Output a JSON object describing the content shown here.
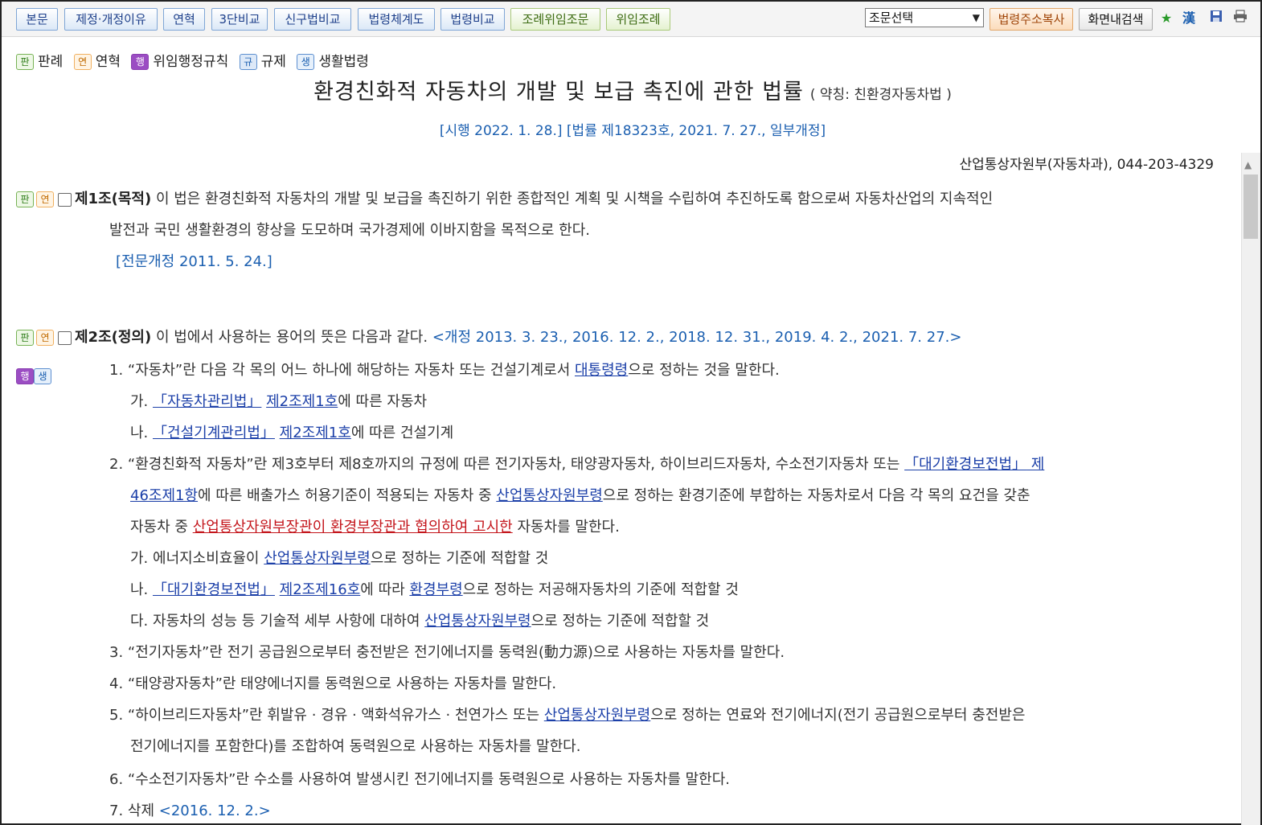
{
  "toolbar": {
    "buttons": [
      "본문",
      "제정·개정이유",
      "연혁",
      "3단비교",
      "신구법비교",
      "법령체계도",
      "법령비교",
      "조례위임조문",
      "위임조례"
    ],
    "select_value": "조문선택",
    "copy_button": "법령주소복사",
    "search_button": "화면내검색",
    "hanja_icon": "漢"
  },
  "legend": [
    {
      "badge": "판",
      "label": "판례"
    },
    {
      "badge": "연",
      "label": "연혁"
    },
    {
      "badge": "행",
      "label": "위임행정규칙"
    },
    {
      "badge": "규",
      "label": "규제"
    },
    {
      "badge": "생",
      "label": "생활법령"
    }
  ],
  "law": {
    "title": "환경친화적 자동차의 개발 및 보급 촉진에 관한 법률",
    "abbr": "( 약칭: 친환경자동차법 )",
    "enforcement": "[시행 2022. 1. 28.] [법률 제18323호, 2021. 7. 27., 일부개정]",
    "ministry": "산업통상자원부(자동차과), 044-203-4329"
  },
  "art1": {
    "badge1": "판",
    "badge2": "연",
    "title": "제1조(목적)",
    "text1": " 이 법은 환경친화적 자동차의 개발 및 보급을 촉진하기 위한 종합적인 계획 및 시책을 수립하여 추진하도록 함으로써 자동차산업의 지속적인",
    "text2": "발전과 국민 생활환경의 향상을 도모하며 국가경제에 이바지함을 목적으로 한다.",
    "amend": "[전문개정 2011. 5. 24.]"
  },
  "art2": {
    "badge1": "판",
    "badge2": "연",
    "badge3": "행",
    "badge4": "생",
    "title": "제2조(정의)",
    "text": " 이 법에서 사용하는 용어의 뜻은 다음과 같다.",
    "amend": "<개정 2013. 3. 23., 2016. 12. 2., 2018. 12. 31., 2019. 4. 2., 2021. 7. 27.>",
    "i1_a": "1. “자동차”란 다음 각 목의 어느 하나에 해당하는 자동차 또는 건설기계로서 ",
    "i1_link": "대통령령",
    "i1_b": "으로 정하는 것을 말한다.",
    "i1ga_pre": "가. ",
    "i1ga_law": "「자동차관리법」",
    "i1ga_art": "제2조제1호",
    "i1ga_post": "에 따른 자동차",
    "i1na_pre": "나. ",
    "i1na_law": "「건설기계관리법」",
    "i1na_art": "제2조제1호",
    "i1na_post": "에 따른 건설기계",
    "i2_a": "2. “환경친화적 자동차”란 제3호부터 제8호까지의 규정에 따른 전기자동차, 태양광자동차, 하이브리드자동차, 수소전기자동차 또는 ",
    "i2_law": "「대기환경보전법」",
    "i2_art1": " 제",
    "i2_art2": "46조제1항",
    "i2_b": "에 따른 배출가스 허용기준이 적용되는 자동차 중 ",
    "i2_link1": "산업통상자원부령",
    "i2_c": "으로 정하는 환경기준에 부합하는 자동차로서 다음 각 목의 요건을 갖춘",
    "i2_d": "자동차 중 ",
    "i2_link_red": "산업통상자원부장관이 환경부장관과 협의하여 고시한",
    "i2_e": " 자동차를 말한다.",
    "i2ga_a": "가. 에너지소비효율이 ",
    "i2ga_link": "산업통상자원부령",
    "i2ga_b": "으로 정하는 기준에 적합할 것",
    "i2na_pre": "나. ",
    "i2na_law": "「대기환경보전법」",
    "i2na_art": "제2조제16호",
    "i2na_mid": "에 따라 ",
    "i2na_link": "환경부령",
    "i2na_post": "으로 정하는 저공해자동차의 기준에 적합할 것",
    "i2da_a": "다. 자동차의 성능 등 기술적 세부 사항에 대하여 ",
    "i2da_link": "산업통상자원부령",
    "i2da_b": "으로 정하는 기준에 적합할 것",
    "i3": "3. “전기자동차”란 전기 공급원으로부터 충전받은 전기에너지를 동력원(動力源)으로 사용하는 자동차를 말한다.",
    "i4": "4. “태양광자동차”란 태양에너지를 동력원으로 사용하는 자동차를 말한다.",
    "i5_a": "5. “하이브리드자동차”란 휘발유 · 경유 · 액화석유가스 · 천연가스 또는 ",
    "i5_link": "산업통상자원부령",
    "i5_b": "으로 정하는 연료와 전기에너지(전기 공급원으로부터 충전받은",
    "i5_c": "전기에너지를 포함한다)를 조합하여 동력원으로 사용하는 자동차를 말한다.",
    "i6": "6. “수소전기자동차”란 수소를 사용하여 발생시킨 전기에너지를 동력원으로 사용하는 자동차를 말한다.",
    "i7": "7. 삭제 ",
    "i7_amend": "<2016. 12. 2.>"
  }
}
